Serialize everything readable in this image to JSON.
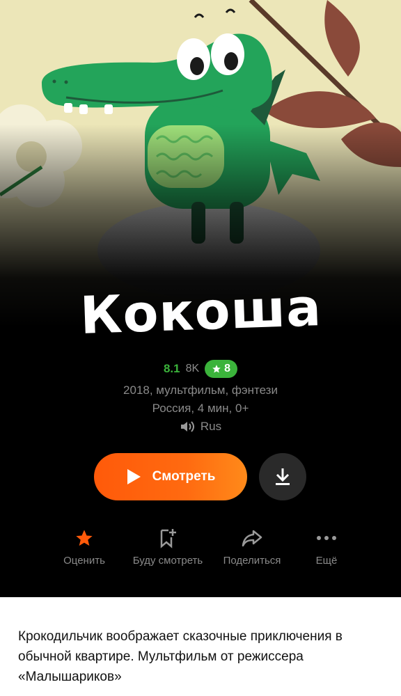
{
  "title": {
    "logo_text": "Кокоша"
  },
  "rating": {
    "score": "8.1",
    "votes": "8K",
    "badge_value": "8"
  },
  "info": {
    "line1": "2018, мультфильм, фэнтези",
    "line2": "Россия, 4 мин, 0+",
    "audio": "Rus"
  },
  "buttons": {
    "watch": "Смотреть"
  },
  "actions": [
    {
      "label": "Оценить",
      "icon": "star-icon"
    },
    {
      "label": "Буду смотреть",
      "icon": "bookmark-add-icon"
    },
    {
      "label": "Поделиться",
      "icon": "share-icon"
    },
    {
      "label": "Ещё",
      "icon": "more-icon"
    }
  ],
  "description": "Крокодильчик воображает сказочные приключения в обычной квартире. Мультфильм от режиссера «Малышариков»",
  "colors": {
    "accent_orange": "#ff5a0a",
    "rating_green": "#3bb33b",
    "star_orange": "#ff5a0a"
  }
}
